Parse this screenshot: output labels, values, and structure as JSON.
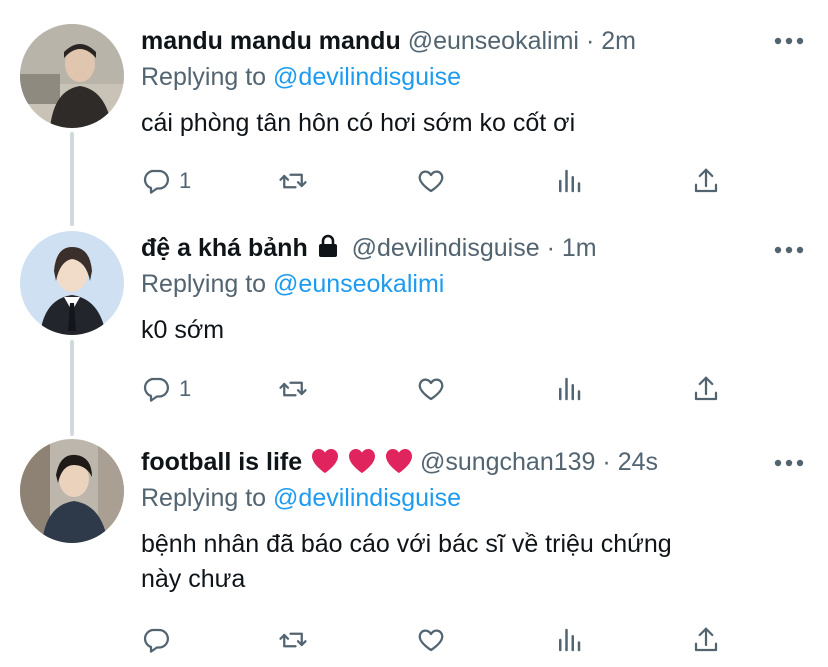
{
  "tweets": [
    {
      "name": "mandu mandu mandu",
      "handle": "@eunseokalimi",
      "time": "2m",
      "replying_prefix": "Replying to",
      "replying_to": "@devilindisguise",
      "text": "cái phòng tân hôn có hơi sớm ko cốt ơi",
      "reply_count": "1",
      "locked": false
    },
    {
      "name": "đệ a khá bảnh",
      "handle": "@devilindisguise",
      "time": "1m",
      "replying_prefix": "Replying to",
      "replying_to": "@eunseokalimi",
      "text": "k0 sớm",
      "reply_count": "1",
      "locked": true
    },
    {
      "name": "football is life",
      "handle": "@sungchan139",
      "time": "24s",
      "replying_prefix": "Replying to",
      "replying_to": "@devilindisguise",
      "text_line1": "bệnh nhân đã báo cáo với bác sĩ về triệu chứng",
      "text_line2": "này chưa",
      "reply_count": "",
      "locked": false
    }
  ],
  "separator": "·",
  "icons": {
    "reply": "reply-bubble-icon",
    "retweet": "retweet-icon",
    "like": "heart-icon",
    "analytics": "analytics-bars-icon",
    "share": "share-upload-icon",
    "more": "more-dots-icon",
    "lock": "lock-icon",
    "emoji": "red-heart-emoji"
  },
  "colors": {
    "accent": "#1d9bf0",
    "secondary_text": "#536471",
    "thread_line": "#cfd9de",
    "emoji_red": "#e0245e"
  }
}
